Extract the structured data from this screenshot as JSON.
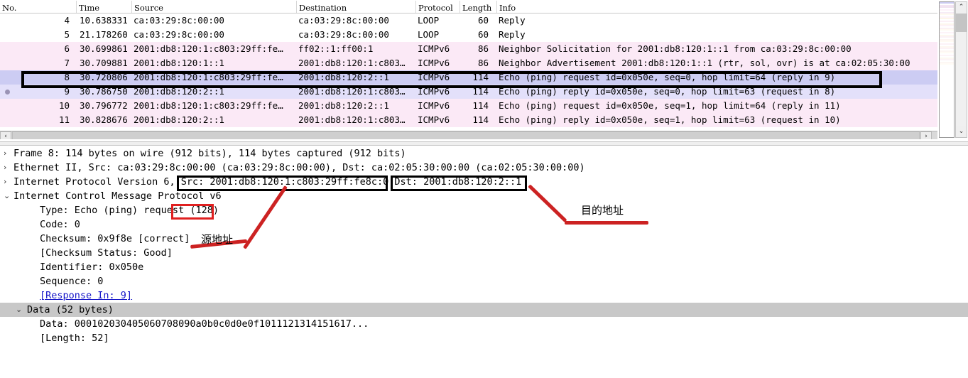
{
  "packet_list": {
    "columns": [
      {
        "key": "no",
        "label": "No."
      },
      {
        "key": "time",
        "label": "Time"
      },
      {
        "key": "source",
        "label": "Source"
      },
      {
        "key": "destination",
        "label": "Destination"
      },
      {
        "key": "protocol",
        "label": "Protocol"
      },
      {
        "key": "length",
        "label": "Length"
      },
      {
        "key": "info",
        "label": "Info"
      }
    ],
    "rows": [
      {
        "no": "4",
        "time": "10.638331",
        "source": "ca:03:29:8c:00:00",
        "destination": "ca:03:29:8c:00:00",
        "protocol": "LOOP",
        "length": "60",
        "info": "Reply",
        "color": "white",
        "marked": false,
        "selected": false
      },
      {
        "no": "5",
        "time": "21.178260",
        "source": "ca:03:29:8c:00:00",
        "destination": "ca:03:29:8c:00:00",
        "protocol": "LOOP",
        "length": "60",
        "info": "Reply",
        "color": "white",
        "marked": false,
        "selected": false
      },
      {
        "no": "6",
        "time": "30.699861",
        "source": "2001:db8:120:1:c803:29ff:fe…",
        "destination": "ff02::1:ff00:1",
        "protocol": "ICMPv6",
        "length": "86",
        "info": "Neighbor Solicitation for 2001:db8:120:1::1 from ca:03:29:8c:00:00",
        "color": "pink",
        "marked": false,
        "selected": false
      },
      {
        "no": "7",
        "time": "30.709881",
        "source": "2001:db8:120:1::1",
        "destination": "2001:db8:120:1:c803…",
        "protocol": "ICMPv6",
        "length": "86",
        "info": "Neighbor Advertisement 2001:db8:120:1::1 (rtr, sol, ovr) is at ca:02:05:30:00",
        "color": "pink",
        "marked": false,
        "selected": false
      },
      {
        "no": "8",
        "time": "30.720806",
        "source": "2001:db8:120:1:c803:29ff:fe…",
        "destination": "2001:db8:120:2::1",
        "protocol": "ICMPv6",
        "length": "114",
        "info": "Echo (ping) request id=0x050e, seq=0, hop limit=64 (reply in 9)",
        "color": "blue",
        "marked": false,
        "selected": true
      },
      {
        "no": "9",
        "time": "30.786750",
        "source": "2001:db8:120:2::1",
        "destination": "2001:db8:120:1:c803…",
        "protocol": "ICMPv6",
        "length": "114",
        "info": "Echo (ping) reply id=0x050e, seq=0, hop limit=63 (request in 8)",
        "color": "lav",
        "marked": true,
        "selected": false
      },
      {
        "no": "10",
        "time": "30.796772",
        "source": "2001:db8:120:1:c803:29ff:fe…",
        "destination": "2001:db8:120:2::1",
        "protocol": "ICMPv6",
        "length": "114",
        "info": "Echo (ping) request id=0x050e, seq=1, hop limit=64 (reply in 11)",
        "color": "pink",
        "marked": false,
        "selected": false
      },
      {
        "no": "11",
        "time": "30.828676",
        "source": "2001:db8:120:2::1",
        "destination": "2001:db8:120:1:c803…",
        "protocol": "ICMPv6",
        "length": "114",
        "info": "Echo (ping) reply id=0x050e, seq=1, hop limit=63 (request in 10)",
        "color": "pink",
        "marked": false,
        "selected": false
      }
    ]
  },
  "detail_tree": [
    {
      "indent": 0,
      "twisty": "collapsed",
      "text": "Frame 8: 114 bytes on wire (912 bits), 114 bytes captured (912 bits)",
      "selected": false,
      "link": false
    },
    {
      "indent": 0,
      "twisty": "collapsed",
      "text": "Ethernet II, Src: ca:03:29:8c:00:00 (ca:03:29:8c:00:00), Dst: ca:02:05:30:00:00 (ca:02:05:30:00:00)",
      "selected": false,
      "link": false
    },
    {
      "indent": 0,
      "twisty": "collapsed",
      "text": "Internet Protocol Version 6, Src: 2001:db8:120:1:c803:29ff:fe8c:0 Dst: 2001:db8:120:2::1",
      "selected": false,
      "link": false
    },
    {
      "indent": 0,
      "twisty": "expanded",
      "text": "Internet Control Message Protocol v6",
      "selected": false,
      "link": false
    },
    {
      "indent": 2,
      "twisty": "none",
      "text": "Type: Echo (ping) request (128)",
      "selected": false,
      "link": false
    },
    {
      "indent": 2,
      "twisty": "none",
      "text": "Code: 0",
      "selected": false,
      "link": false
    },
    {
      "indent": 2,
      "twisty": "none",
      "text": "Checksum: 0x9f8e [correct]",
      "selected": false,
      "link": false
    },
    {
      "indent": 2,
      "twisty": "none",
      "text": "[Checksum Status: Good]",
      "selected": false,
      "link": false
    },
    {
      "indent": 2,
      "twisty": "none",
      "text": "Identifier: 0x050e",
      "selected": false,
      "link": false
    },
    {
      "indent": 2,
      "twisty": "none",
      "text": "Sequence: 0",
      "selected": false,
      "link": false
    },
    {
      "indent": 2,
      "twisty": "none",
      "text": "[Response In: 9]",
      "selected": false,
      "link": true
    },
    {
      "indent": 1,
      "twisty": "expanded",
      "text": "Data (52 bytes)",
      "selected": true,
      "link": false
    },
    {
      "indent": 2,
      "twisty": "none",
      "text": "Data: 000102030405060708090a0b0c0d0e0f1011121314151617...",
      "selected": false,
      "link": false
    },
    {
      "indent": 2,
      "twisty": "none",
      "text": "[Length: 52]",
      "selected": false,
      "link": false
    }
  ],
  "annotations": {
    "source_label": "源地址",
    "destination_label": "目的地址",
    "highlight_src_text": "Src: 2001:db8:120:1:c803:29ff:fe8c:0",
    "highlight_dst_text": "Dst: 2001:db8:120:2::1",
    "highlight_type_text": "(128)"
  },
  "colors": {
    "row_white": "#ffffff",
    "row_pink": "#fbe9f6",
    "row_blue": "#ccccf3",
    "row_lavender": "#e3e0fa",
    "annotation_red": "#cc2222",
    "highlight_box_black": "#000000",
    "link_blue": "#1414c8",
    "selected_detail_gray": "#c8c8c8"
  },
  "scrollbars": {
    "h_left_arrow": "‹",
    "h_right_arrow": "›",
    "v_up_arrow": "⌃",
    "v_down_arrow": "⌄"
  },
  "minimap": {
    "stripes": [
      "#c9c9ef",
      "#ffffff",
      "#f4e4f2",
      "#f0e2f0",
      "#ffffff",
      "#fdf2fa",
      "#ffffff",
      "#f6ecf6",
      "#fffaf0",
      "#ffffff",
      "#fdf4f8",
      "#fdf6e9",
      "#ffffff",
      "#fbf0f6",
      "#ffffff",
      "#fdf6ee",
      "#fdf2f8",
      "#ffffff",
      "#fbf1f3",
      "#fffaf2",
      "#ffffff",
      "#fdf3f8",
      "#ffffff",
      "#fdf7ef",
      "#fbf1f6",
      "#ffffff",
      "#fdf5f2",
      "#fffbf3",
      "#ffffff",
      "#fcf2f7",
      "#ffffff",
      "#fdf8f1",
      "#fcf3f6",
      "#ffffff",
      "#fdf6f3",
      "#fffcf5",
      "#ffffff",
      "#fdf4f8",
      "#ffffff",
      "#fdf8f2",
      "#fcf4f7",
      "#ffffff",
      "#fdf7f4",
      "#fffcf6",
      "#ffffff"
    ]
  }
}
